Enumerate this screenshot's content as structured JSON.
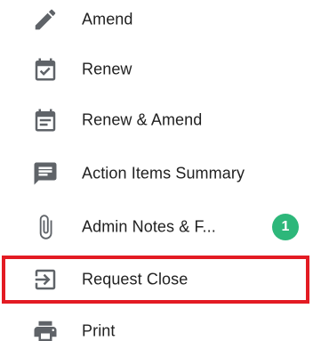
{
  "menu": {
    "items": [
      {
        "label": "Amend",
        "icon": "pencil-icon"
      },
      {
        "label": "Renew",
        "icon": "calendar-check-icon"
      },
      {
        "label": "Renew & Amend",
        "icon": "calendar-note-icon"
      },
      {
        "label": "Action Items Summary",
        "icon": "comment-summary-icon"
      },
      {
        "label": "Admin Notes & F...",
        "icon": "paperclip-icon",
        "badge": "1"
      },
      {
        "label": "Request Close",
        "icon": "exit-to-app-icon",
        "highlighted": true
      },
      {
        "label": "Print",
        "icon": "printer-icon"
      }
    ]
  },
  "colors": {
    "icon": "#5f6368",
    "text": "#212121",
    "badge": "#2db77a",
    "highlight": "#e31b23"
  }
}
